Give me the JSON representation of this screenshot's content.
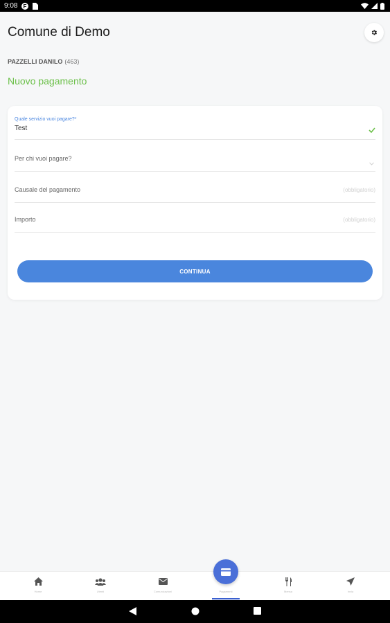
{
  "status_bar": {
    "time": "9:08",
    "icons": [
      "app-f-icon",
      "sim-icon",
      "wifi-icon",
      "signal-icon",
      "battery-icon"
    ]
  },
  "header": {
    "title": "Comune di Demo",
    "settings_icon": "gear-icon"
  },
  "user": {
    "name": "PAZZELLI DANILO",
    "code": "(463)"
  },
  "page_title": "Nuovo pagamento",
  "form": {
    "service": {
      "label": "Quale servizio vuoi pagare?*",
      "value": "Test"
    },
    "payer": {
      "label": "Per chi vuoi pagare?"
    },
    "causale": {
      "label": "Causale del pagamento",
      "placeholder": "(obbligatorio)"
    },
    "importo": {
      "label": "Importo",
      "placeholder": "(obbligatorio)"
    },
    "continue_label": "CONTINUA"
  },
  "bottom_nav": {
    "items": [
      {
        "icon": "home-icon",
        "label": "Home"
      },
      {
        "icon": "users-icon",
        "label": "Utenti"
      },
      {
        "icon": "mail-icon",
        "label": "Comunicazioni"
      },
      {
        "icon": "card-icon",
        "label": "Pagamenti"
      },
      {
        "icon": "fork-knife-icon",
        "label": "Mensa"
      },
      {
        "icon": "send-icon",
        "label": "Invia"
      }
    ]
  },
  "colors": {
    "accent_green": "#6cc04a",
    "primary_blue": "#4a86dd",
    "fab_blue": "#4a6fd8"
  }
}
